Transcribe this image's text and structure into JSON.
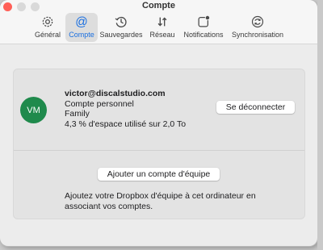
{
  "window": {
    "title": "Compte"
  },
  "toolbar": {
    "tabs": [
      {
        "label": "Général",
        "icon": "gear-icon"
      },
      {
        "label": "Compte",
        "icon": "at-icon",
        "active": true
      },
      {
        "label": "Sauvegardes",
        "icon": "history-icon"
      },
      {
        "label": "Réseau",
        "icon": "network-icon"
      },
      {
        "label": "Notifications",
        "icon": "notification-icon"
      },
      {
        "label": "Synchronisation",
        "icon": "sync-icon"
      }
    ]
  },
  "account": {
    "avatar_initials": "VM",
    "email": "victor@discalstudio.com",
    "type": "Compte personnel",
    "plan": "Family",
    "usage": "4,3 % d'espace utilisé sur 2,0 To",
    "logout_label": "Se déconnecter"
  },
  "team": {
    "add_button_label": "Ajouter un compte d'équipe",
    "description": "Ajoutez votre Dropbox d'équipe à cet ordinateur en associant vos comptes."
  },
  "colors": {
    "accent": "#1a6fe0",
    "avatar": "#1f8a4c"
  }
}
